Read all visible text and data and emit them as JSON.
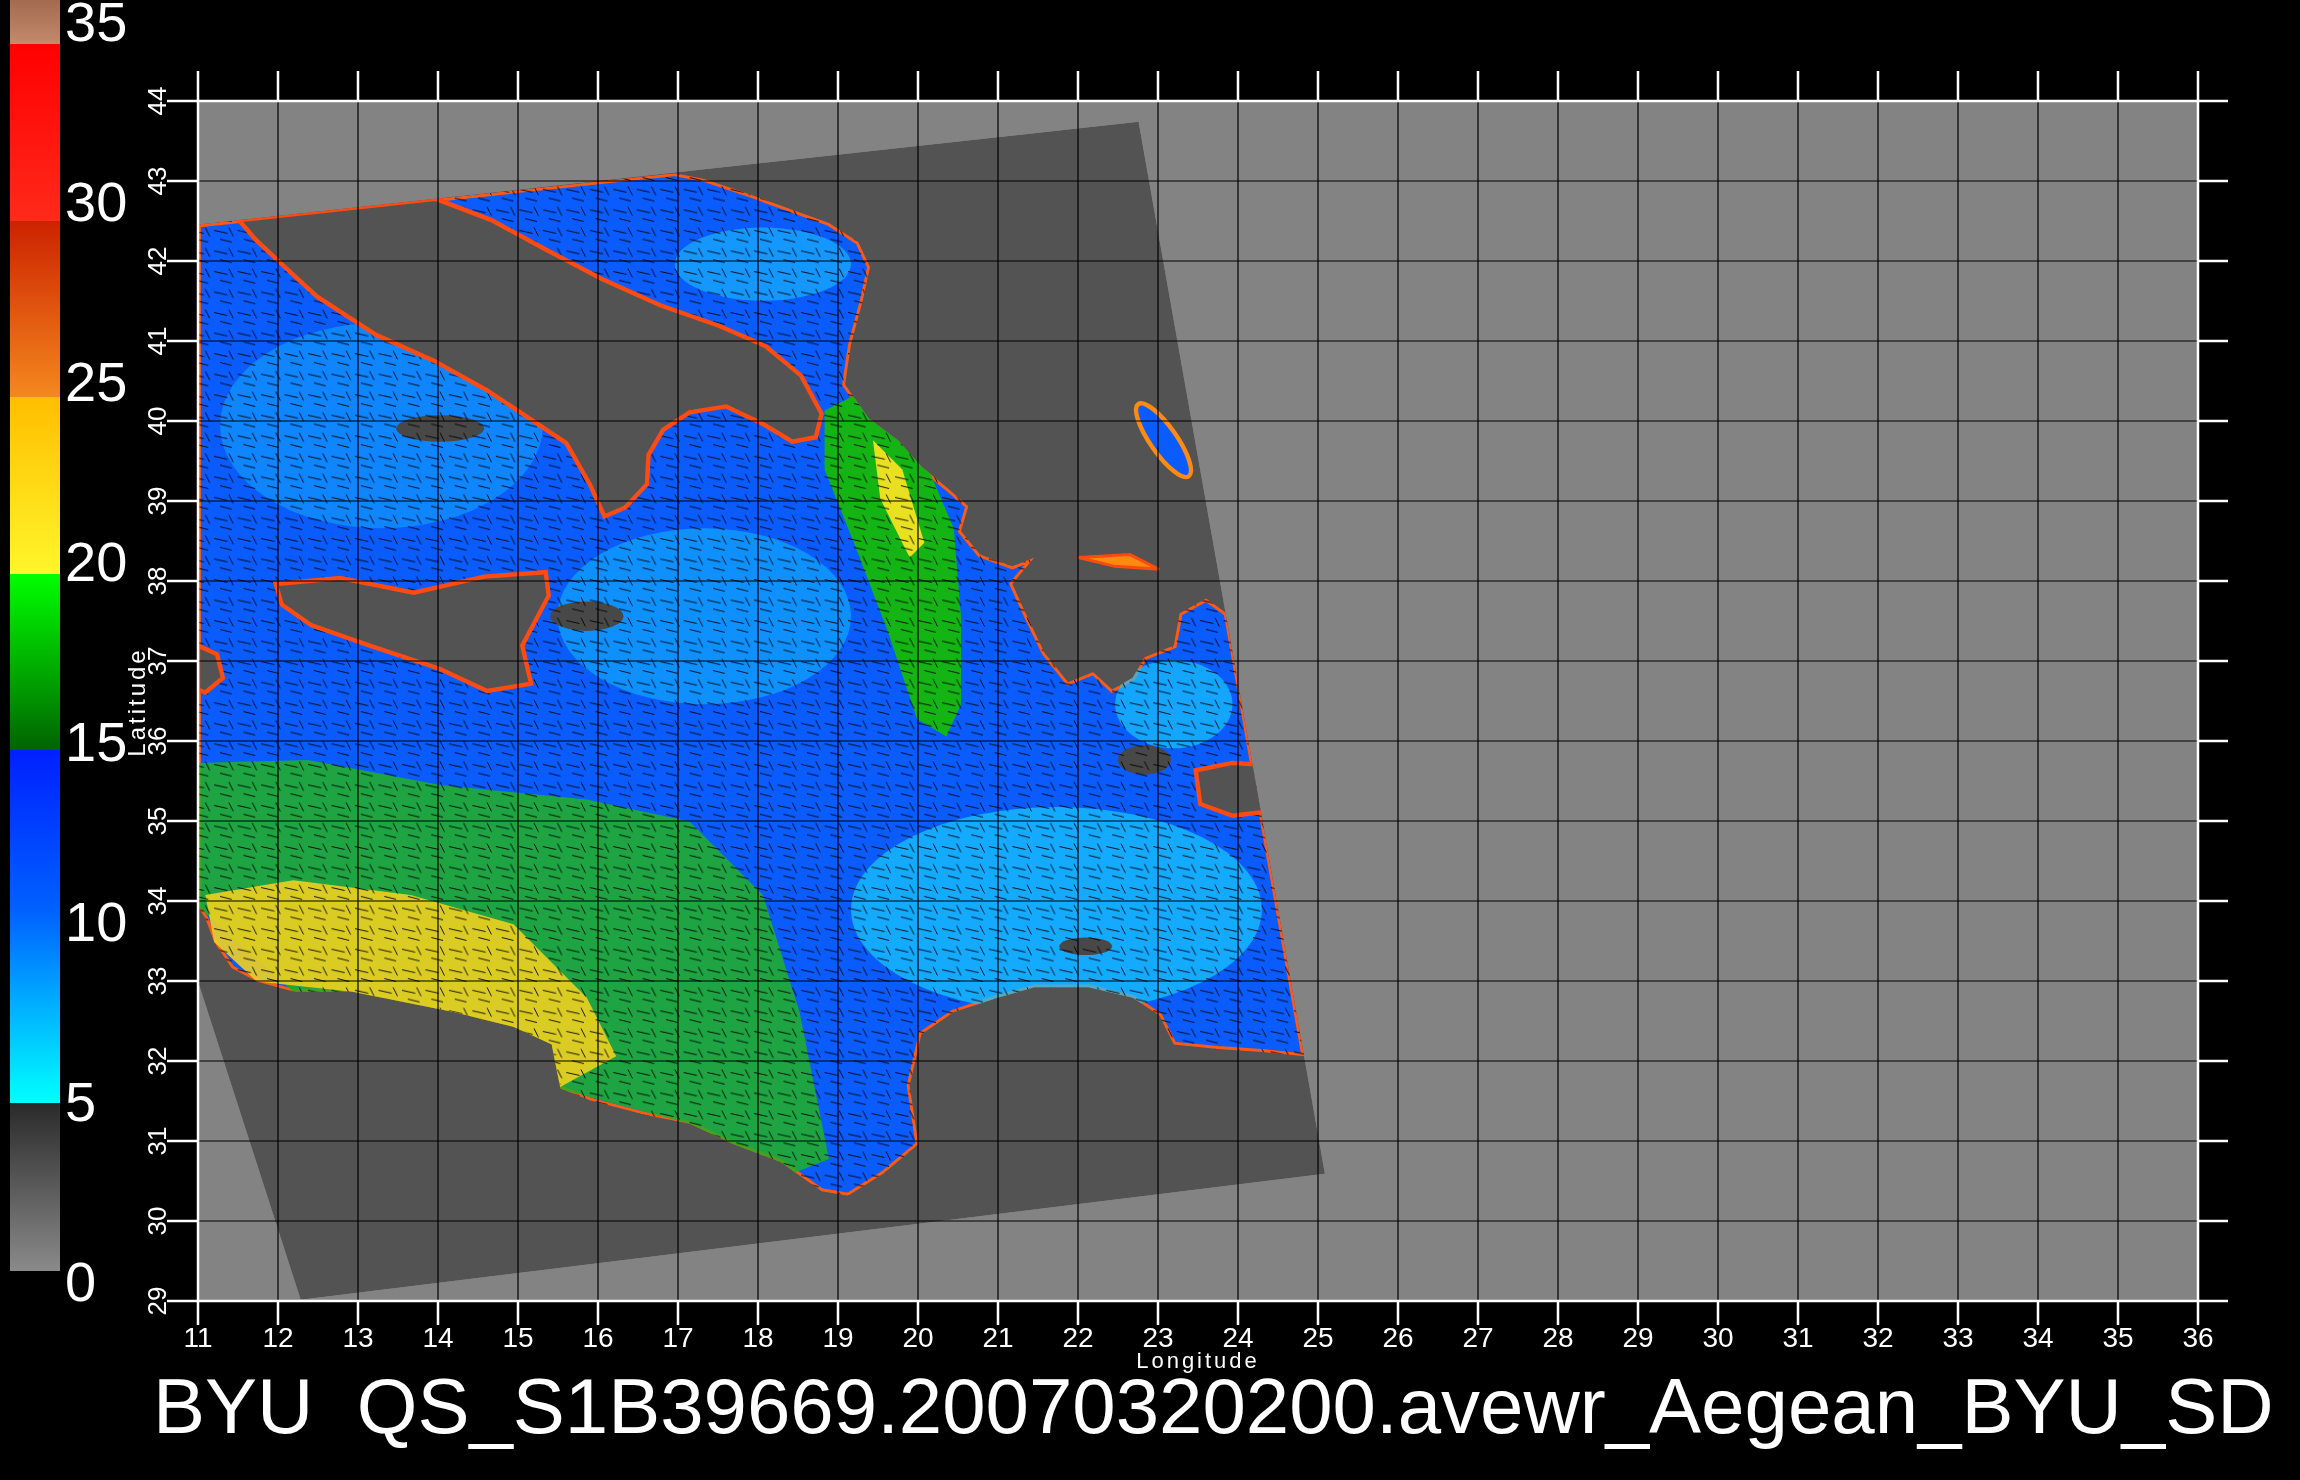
{
  "colorbar": {
    "labels": [
      "35",
      "30",
      "25",
      "20",
      "15",
      "10",
      "5",
      "0"
    ]
  },
  "map": {
    "y_axis": {
      "label": "Latitude",
      "ticks": [
        "44",
        "43",
        "42",
        "41",
        "40",
        "39",
        "38",
        "37",
        "36",
        "35",
        "34",
        "33",
        "32",
        "31",
        "30",
        "29"
      ]
    },
    "x_axis": {
      "ticks": [
        "11",
        "12",
        "13",
        "14",
        "15",
        "16",
        "17",
        "18",
        "19",
        "20",
        "21",
        "22",
        "23",
        "24",
        "25",
        "26",
        "27",
        "28",
        "29",
        "30",
        "31",
        "32",
        "33",
        "34",
        "35",
        "36"
      ],
      "label": "Longitude"
    }
  },
  "caption": "BYU  QS_S1B39669.20070320200.avewr_Aegean_BYU_SD"
}
